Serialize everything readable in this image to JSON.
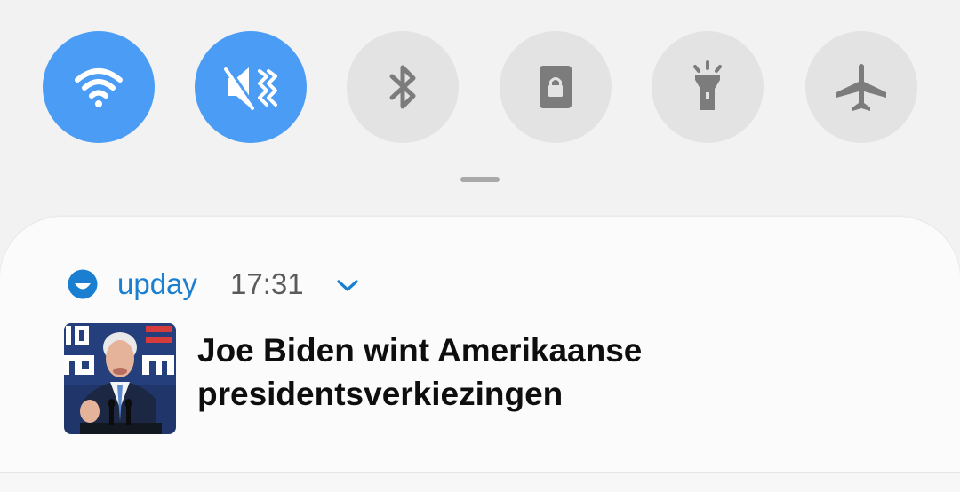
{
  "quick_settings": {
    "tiles": [
      {
        "id": "wifi",
        "icon": "wifi-icon",
        "state": "on"
      },
      {
        "id": "sound",
        "icon": "vibrate-mute-icon",
        "state": "on"
      },
      {
        "id": "bluetooth",
        "icon": "bluetooth-icon",
        "state": "off"
      },
      {
        "id": "rotation-lock",
        "icon": "portrait-lock-icon",
        "state": "off"
      },
      {
        "id": "flashlight",
        "icon": "flashlight-icon",
        "state": "off"
      },
      {
        "id": "airplane-mode",
        "icon": "airplane-icon",
        "state": "off"
      }
    ],
    "colors": {
      "active": "#4a9cf4",
      "inactive": "#e3e3e3",
      "active_glyph": "#ffffff",
      "inactive_glyph": "#7c7c7c"
    }
  },
  "notification": {
    "app_name": "upday",
    "time": "17:31",
    "app_icon": "upday-logo-icon",
    "expand_icon": "chevron-down-icon",
    "headline": "Joe Biden wint Amerikaanse presidentsverkiezingen",
    "thumbnail": "news-photo",
    "colors": {
      "app_name": "#1a7fd1",
      "headline": "#0e0e0e"
    }
  }
}
